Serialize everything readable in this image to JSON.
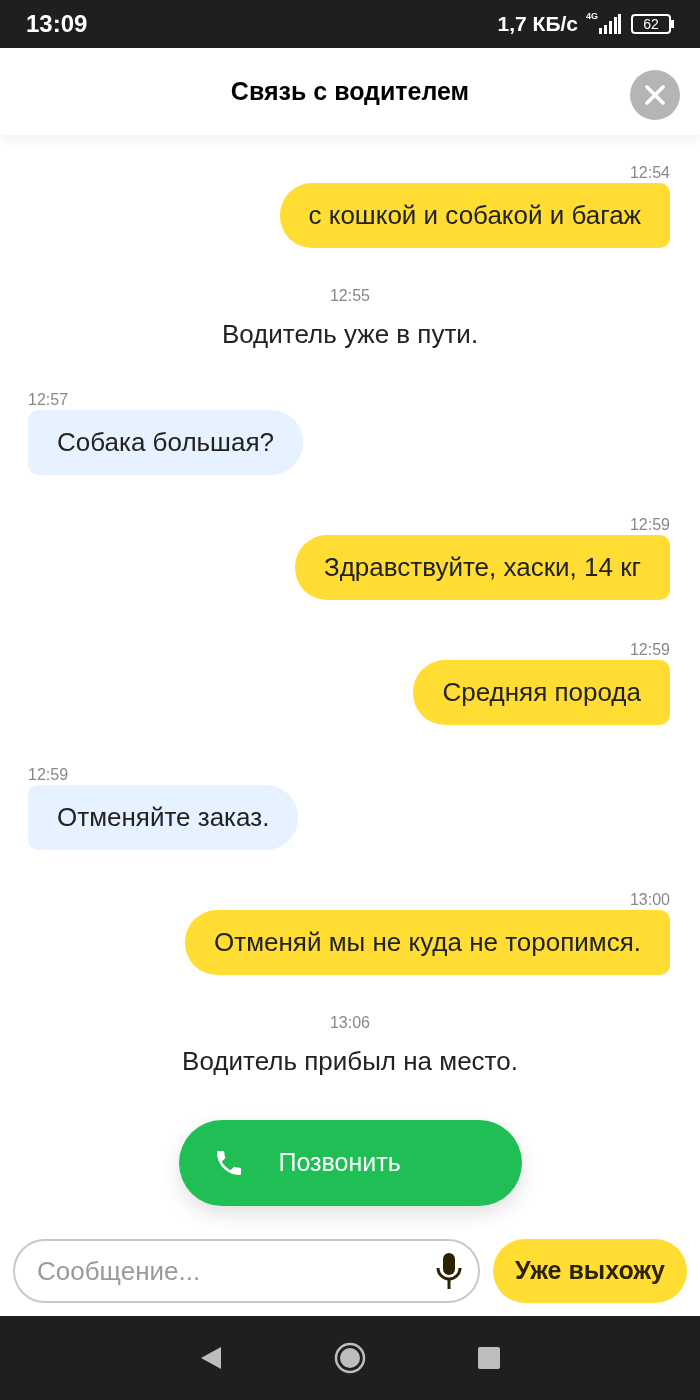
{
  "status_bar": {
    "time": "13:09",
    "speed": "1,7 КБ/с",
    "network": "4G",
    "battery": "62"
  },
  "header": {
    "title": "Связь с водителем"
  },
  "messages": [
    {
      "kind": "outgoing",
      "time": "12:54",
      "text": "с кошкой и собакой и багаж"
    },
    {
      "kind": "system",
      "time": "12:55",
      "text": "Водитель уже в пути."
    },
    {
      "kind": "incoming",
      "time": "12:57",
      "text": "Собака большая?"
    },
    {
      "kind": "outgoing",
      "time": "12:59",
      "text": "Здравствуйте, хаски, 14 кг"
    },
    {
      "kind": "outgoing",
      "time": "12:59",
      "text": "Средняя порода"
    },
    {
      "kind": "incoming",
      "time": "12:59",
      "text": "Отменяйте заказ."
    },
    {
      "kind": "outgoing",
      "time": "13:00",
      "text": "Отменяй мы не куда не торопимся."
    },
    {
      "kind": "system",
      "time": "13:06",
      "text": "Водитель прибыл на место."
    }
  ],
  "call_button": {
    "label": "Позвонить"
  },
  "composer": {
    "placeholder": "Сообщение...",
    "quick_reply": "Уже выхожу"
  }
}
